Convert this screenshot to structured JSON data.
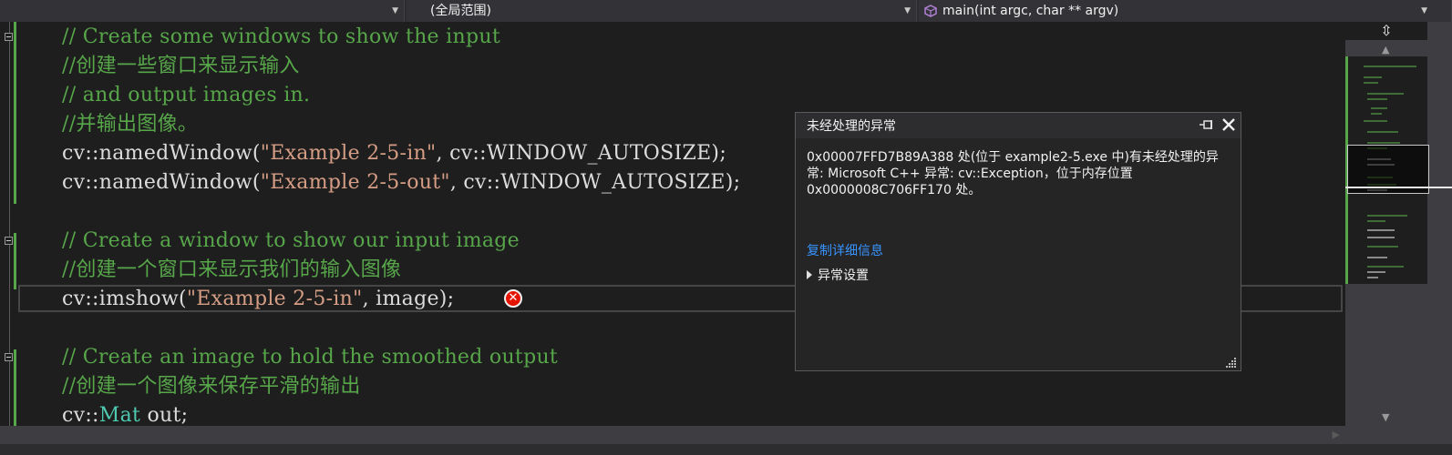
{
  "navbar": {
    "project_dropdown": "",
    "scope_dropdown": "(全局范围)",
    "function_dropdown": "main(int argc, char ** argv)"
  },
  "code": {
    "lines": [
      "// Create some windows to show the input",
      "//创建一些窗口来显示输入",
      "// and output images in.",
      "//并输出图像。",
      "cv::namedWindow(\"Example 2-5-in\", cv::WINDOW_AUTOSIZE);",
      "cv::namedWindow(\"Example 2-5-out\", cv::WINDOW_AUTOSIZE);",
      "",
      "// Create a window to show our input image",
      "//创建一个窗口来显示我们的输入图像",
      "cv::imshow(\"Example 2-5-in\", image);",
      "",
      "// Create an image to hold the smoothed output",
      "//创建一个图像来保存平滑的输出",
      "cv::Mat out;"
    ],
    "segments": {
      "l5_a": "cv::namedWindow(",
      "l5_b": "\"Example 2-5-in\"",
      "l5_c": ", cv::WINDOW_AUTOSIZE);",
      "l6_a": "cv::namedWindow(",
      "l6_b": "\"Example 2-5-out\"",
      "l6_c": ", cv::WINDOW_AUTOSIZE);",
      "l10_a": "cv::imshow(",
      "l10_b": "\"Example 2-5-in\"",
      "l10_c": ", image);",
      "l14_a": "cv::",
      "l14_b": "Mat",
      "l14_c": " out;"
    }
  },
  "exception_popup": {
    "title": "未经处理的异常",
    "message_line1": "0x00007FFD7B89A388 处(位于 example2-5.exe 中)有未经处理的异",
    "message_line2": "常: Microsoft C++ 异常: cv::Exception，位于内存位置",
    "message_line3": "0x0000008C706FF170 处。",
    "copy_details_link": "复制详细信息",
    "exception_settings": "异常设置"
  },
  "colors": {
    "editor_bg": "#1e1e1e",
    "comment": "#57a64a",
    "string": "#d69d85",
    "type": "#4ec9b0",
    "link": "#3794ff",
    "error": "#e51400"
  },
  "icons": {
    "function_icon": "purple-cube-icon",
    "error_icon": "error-x-circle-icon",
    "pin_icon": "pin-icon",
    "close_icon": "close-icon",
    "split_icon": "split-editor-icon"
  }
}
